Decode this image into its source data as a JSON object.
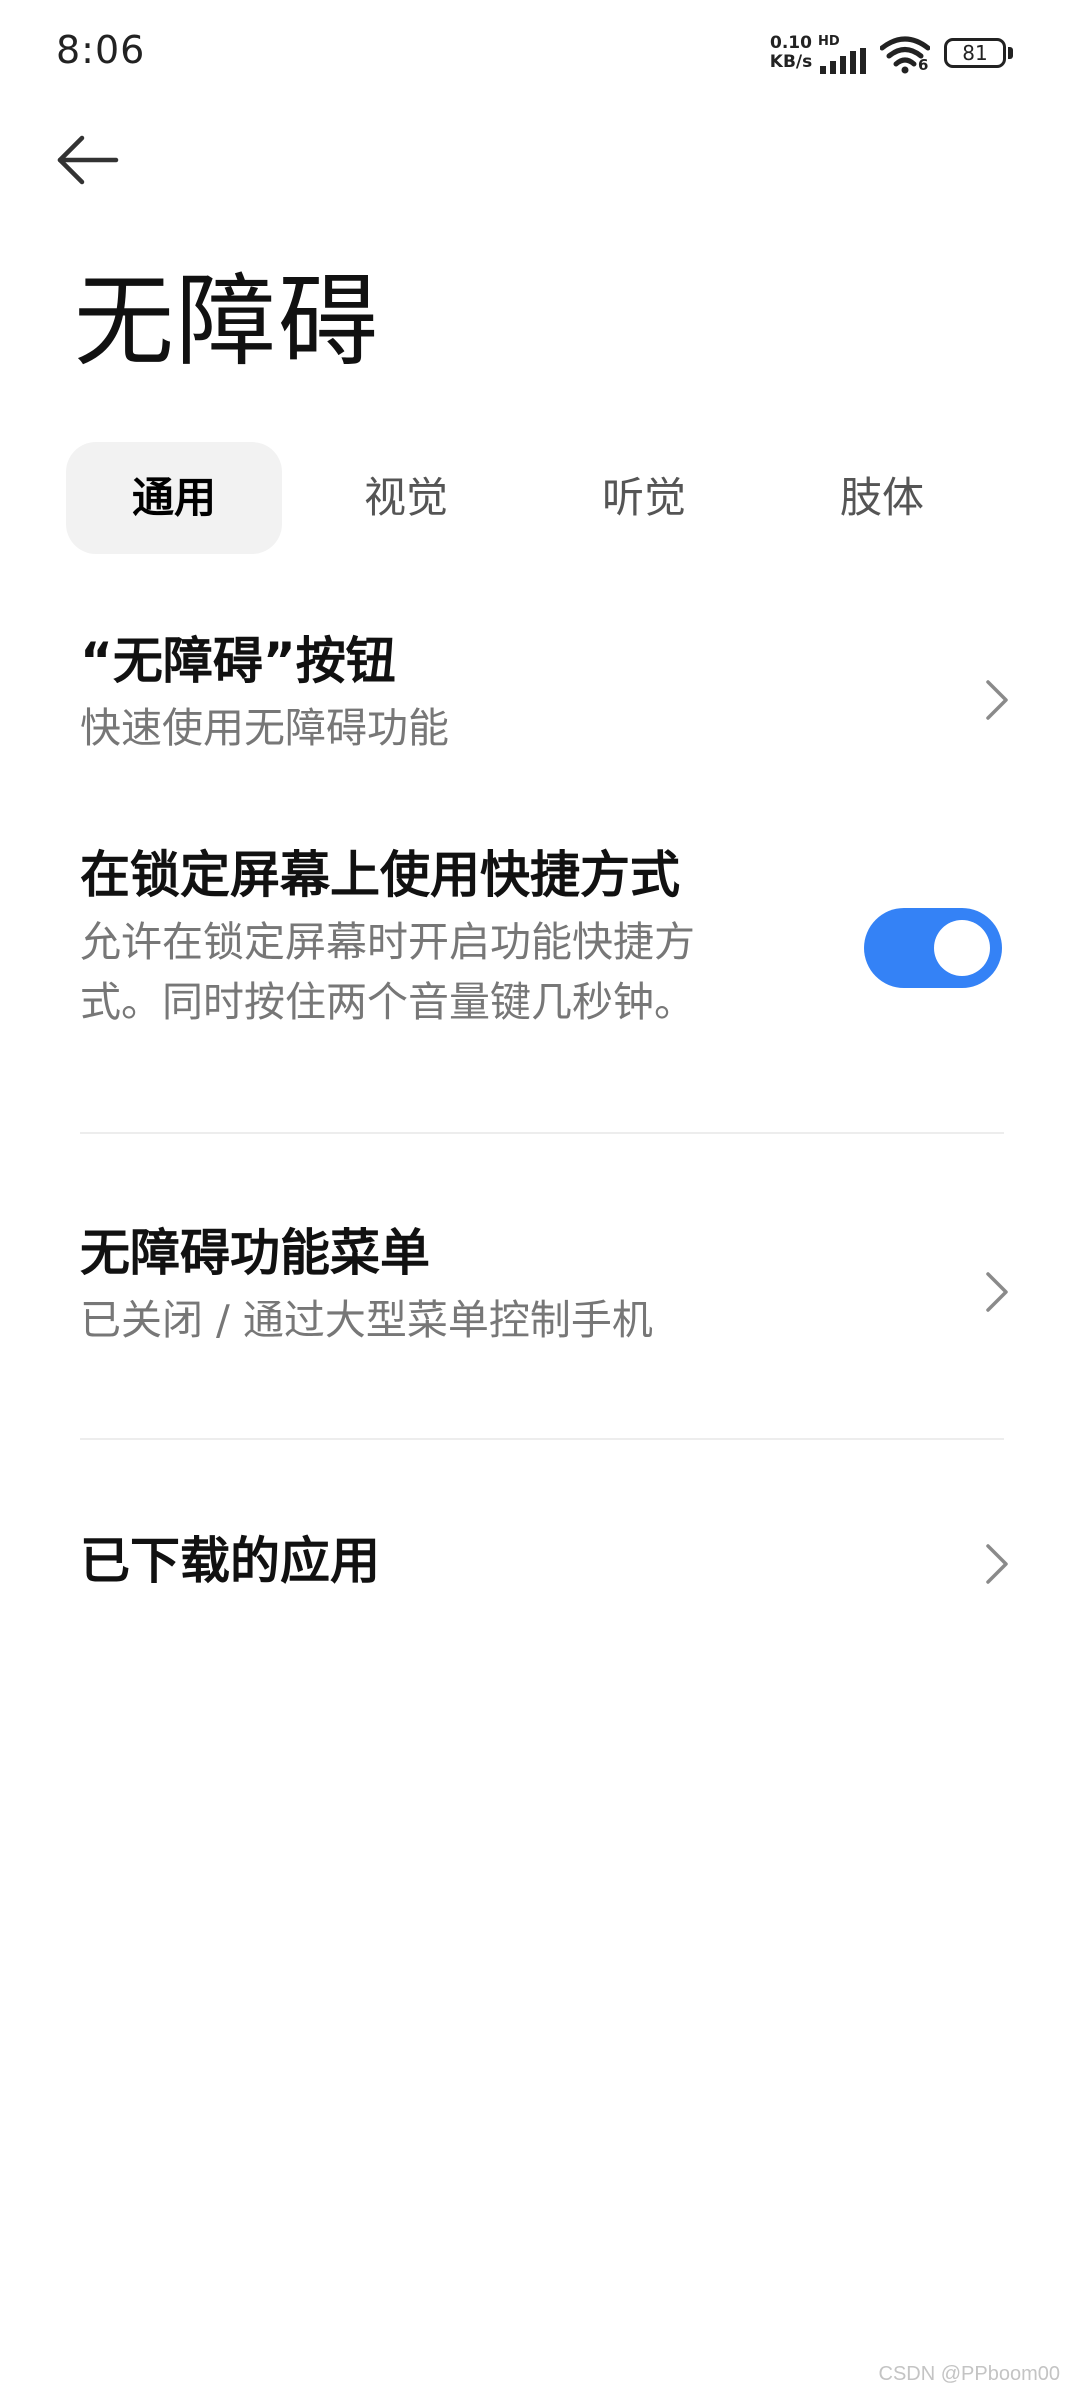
{
  "status_bar": {
    "time": "8:06",
    "net_speed_value": "0.10",
    "net_speed_unit": "KB/s",
    "hd_label": "HD",
    "wifi_label": "6",
    "battery": "81",
    "icons": [
      "signal-icon",
      "wifi-icon",
      "battery-icon"
    ]
  },
  "header": {
    "back_icon": "arrow-left-icon",
    "title": "无障碍"
  },
  "tabs": [
    {
      "label": "通用",
      "active": true
    },
    {
      "label": "视觉",
      "active": false
    },
    {
      "label": "听觉",
      "active": false
    },
    {
      "label": "肢体",
      "active": false
    }
  ],
  "items": [
    {
      "title": "“无障碍”按钮",
      "subtitle": "快速使用无障碍功能",
      "control": "chevron-right-icon"
    },
    {
      "title": "在锁定屏幕上使用快捷方式",
      "subtitle_line1": "允许在锁定屏幕时开启功能快捷方",
      "subtitle_line2": "式。同时按住两个音量键几秒钟。",
      "control": "toggle",
      "toggle_on": true
    },
    {
      "title": "无障碍功能菜单",
      "subtitle": "已关闭 / 通过大型菜单控制手机",
      "control": "chevron-right-icon"
    },
    {
      "title": "已下载的应用",
      "control": "chevron-right-icon"
    }
  ],
  "colors": {
    "accent": "#3482f6",
    "active_tab_bg": "#f2f2f2",
    "subtitle": "#777777"
  },
  "watermark": "CSDN @PPboom00"
}
